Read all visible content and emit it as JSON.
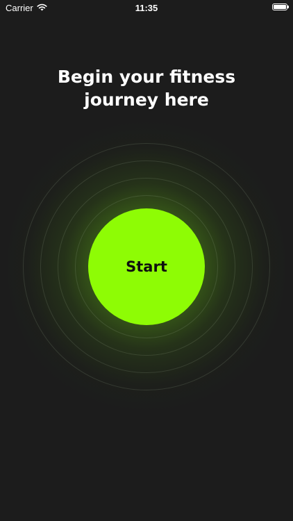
{
  "status_bar": {
    "carrier": "Carrier",
    "time": "11:35",
    "wifi_icon": "wifi-icon",
    "battery_icon": "battery-icon"
  },
  "main": {
    "headline_line1": "Begin your fitness",
    "headline_line2": "journey here",
    "start_label": "Start"
  },
  "colors": {
    "background": "#1c1c1c",
    "accent": "#8efc05",
    "text": "#ffffff"
  }
}
